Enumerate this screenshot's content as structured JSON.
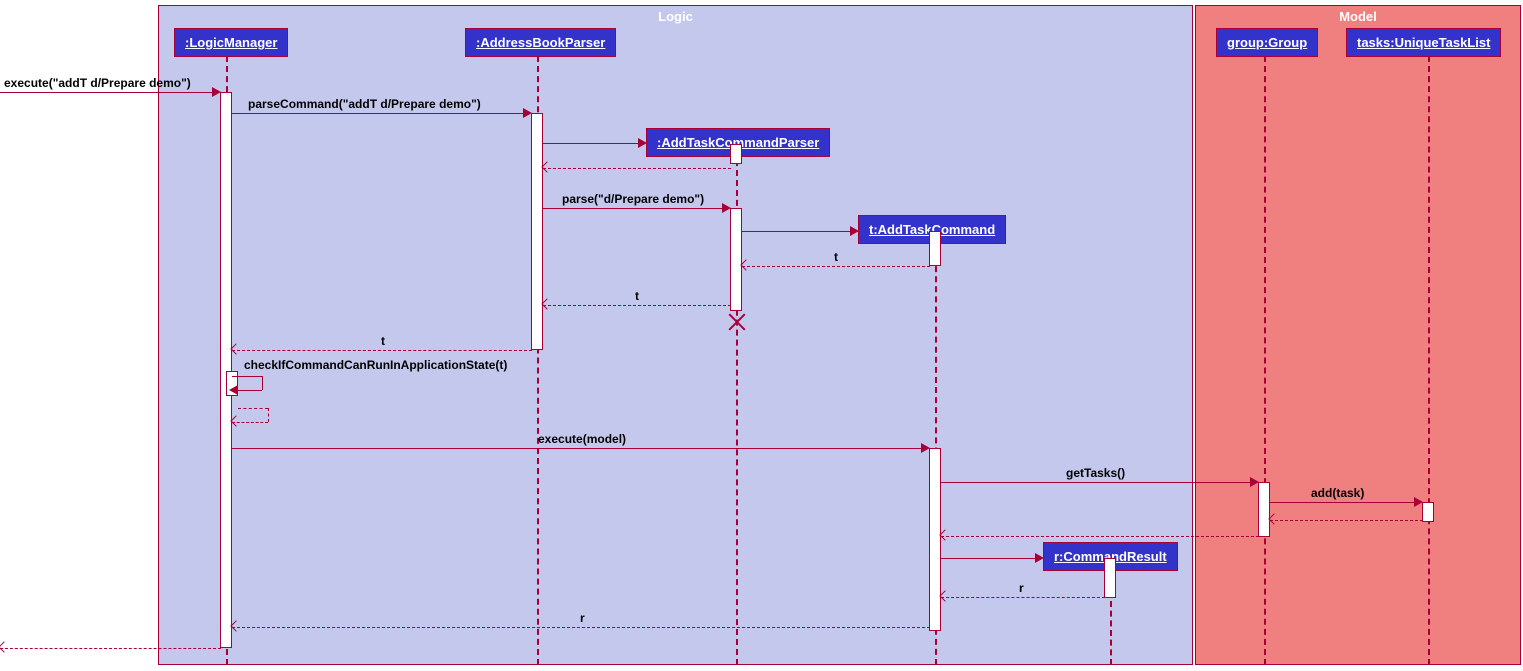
{
  "frames": {
    "logic": "Logic",
    "model": "Model"
  },
  "participants": {
    "logicManager": ":LogicManager",
    "addressBookParser": ":AddressBookParser",
    "addTaskCommandParser": ":AddTaskCommandParser",
    "addTaskCommand": "t:AddTaskCommand",
    "commandResult": "r:CommandResult",
    "group": "group:Group",
    "tasks": "tasks:UniqueTaskList"
  },
  "messages": {
    "execute1": "execute(\"addT d/Prepare demo\")",
    "parseCommand": "parseCommand(\"addT d/Prepare demo\")",
    "parse": "parse(\"d/Prepare demo\")",
    "return_t1": "t",
    "return_t2": "t",
    "return_t3": "t",
    "checkState": "checkIfCommandCanRunInApplicationState(t)",
    "executeModel": "execute(model)",
    "getTasks": "getTasks()",
    "addTask": "add(task)",
    "return_r1": "r",
    "return_r2": "r"
  },
  "chart_data": {
    "type": "sequence",
    "frames": [
      {
        "name": "Logic",
        "participants": [
          ":LogicManager",
          ":AddressBookParser",
          ":AddTaskCommandParser",
          "t:AddTaskCommand",
          "r:CommandResult"
        ]
      },
      {
        "name": "Model",
        "participants": [
          "group:Group",
          "tasks:UniqueTaskList"
        ]
      }
    ],
    "messages": [
      {
        "from": "[",
        "to": ":LogicManager",
        "label": "execute(\"addT d/Prepare demo\")",
        "type": "call"
      },
      {
        "from": ":LogicManager",
        "to": ":AddressBookParser",
        "label": "parseCommand(\"addT d/Prepare demo\")",
        "type": "call"
      },
      {
        "from": ":AddressBookParser",
        "to": ":AddTaskCommandParser",
        "label": "",
        "type": "create"
      },
      {
        "from": ":AddTaskCommandParser",
        "to": ":AddressBookParser",
        "label": "",
        "type": "return"
      },
      {
        "from": ":AddressBookParser",
        "to": ":AddTaskCommandParser",
        "label": "parse(\"d/Prepare demo\")",
        "type": "call"
      },
      {
        "from": ":AddTaskCommandParser",
        "to": "t:AddTaskCommand",
        "label": "",
        "type": "create"
      },
      {
        "from": "t:AddTaskCommand",
        "to": ":AddTaskCommandParser",
        "label": "t",
        "type": "return"
      },
      {
        "from": ":AddTaskCommandParser",
        "to": ":AddressBookParser",
        "label": "t",
        "type": "return"
      },
      {
        "from": ":AddTaskCommandParser",
        "to": ":AddTaskCommandParser",
        "label": "",
        "type": "destroy"
      },
      {
        "from": ":AddressBookParser",
        "to": ":LogicManager",
        "label": "t",
        "type": "return"
      },
      {
        "from": ":LogicManager",
        "to": ":LogicManager",
        "label": "checkIfCommandCanRunInApplicationState(t)",
        "type": "selfcall"
      },
      {
        "from": ":LogicManager",
        "to": "t:AddTaskCommand",
        "label": "execute(model)",
        "type": "call"
      },
      {
        "from": "t:AddTaskCommand",
        "to": "group:Group",
        "label": "getTasks()",
        "type": "call"
      },
      {
        "from": "group:Group",
        "to": "tasks:UniqueTaskList",
        "label": "add(task)",
        "type": "call"
      },
      {
        "from": "tasks:UniqueTaskList",
        "to": "group:Group",
        "label": "",
        "type": "return"
      },
      {
        "from": "group:Group",
        "to": "t:AddTaskCommand",
        "label": "",
        "type": "return"
      },
      {
        "from": "t:AddTaskCommand",
        "to": "r:CommandResult",
        "label": "",
        "type": "create"
      },
      {
        "from": "r:CommandResult",
        "to": "t:AddTaskCommand",
        "label": "r",
        "type": "return"
      },
      {
        "from": "t:AddTaskCommand",
        "to": ":LogicManager",
        "label": "r",
        "type": "return"
      },
      {
        "from": ":LogicManager",
        "to": "[",
        "label": "",
        "type": "return"
      }
    ]
  }
}
